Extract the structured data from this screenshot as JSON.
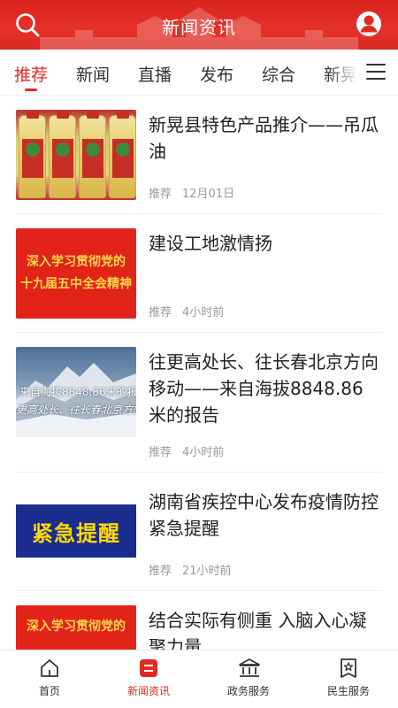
{
  "header": {
    "title": "新闻资讯",
    "left_icon": "search-icon",
    "right_icon": "user-icon",
    "background_color": "#e02a22"
  },
  "tabs": [
    {
      "label": "推荐",
      "active": true
    },
    {
      "label": "新闻",
      "active": false
    },
    {
      "label": "直播",
      "active": false
    },
    {
      "label": "发布",
      "active": false
    },
    {
      "label": "综合",
      "active": false
    },
    {
      "label": "新晃",
      "active": false
    }
  ],
  "tab_menu_icon": "menu-icon",
  "accent_color": "#e02a22",
  "news": [
    {
      "headline": "新晃县特色产品推介——吊瓜油",
      "category": "推荐",
      "time": "12月01日",
      "thumb": {
        "type": "oil-bottles",
        "bottle_text": "吊瓜籽食用油"
      }
    },
    {
      "headline": "建设工地激情扬",
      "category": "推荐",
      "time": "4小时前",
      "thumb": {
        "type": "slogan",
        "line1": "深入学习贯彻党的",
        "line2": "十九届五中全会精神"
      }
    },
    {
      "headline": "往更高处长、往长春北京方向移动——来自海拔8848.86米的报告",
      "category": "推荐",
      "time": "4小时前",
      "thumb": {
        "type": "everest",
        "line1": "来自海拔8848.86米的报告",
        "line2": "更高处长、往长春北京方向"
      }
    },
    {
      "headline": "湖南省疾控中心发布疫情防控紧急提醒",
      "category": "推荐",
      "time": "21小时前",
      "thumb": {
        "type": "urgent",
        "text": "紧急提醒"
      }
    },
    {
      "headline": "结合实际有侧重 入脑入心凝聚力量",
      "category": "推荐",
      "time": "",
      "thumb": {
        "type": "slogan",
        "line1": "深入学习贯彻党的",
        "line2": ""
      }
    }
  ],
  "bottom_nav": [
    {
      "label": "首页",
      "icon": "home-icon",
      "active": false
    },
    {
      "label": "新闻资讯",
      "icon": "news-icon",
      "active": true
    },
    {
      "label": "政务服务",
      "icon": "government-icon",
      "active": false
    },
    {
      "label": "民生服务",
      "icon": "people-service-icon",
      "active": false
    }
  ]
}
